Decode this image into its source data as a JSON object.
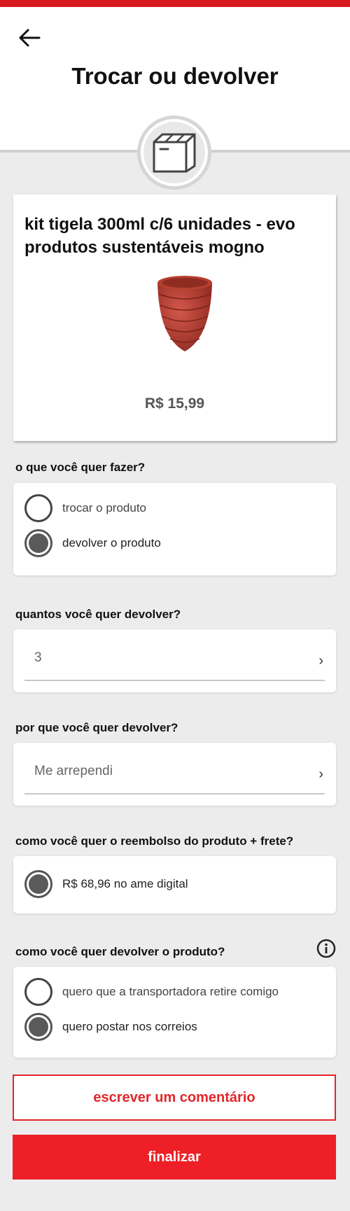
{
  "header": {
    "title": "Trocar ou devolver",
    "back_icon": "arrow-left-icon"
  },
  "product": {
    "name": "kit tigela 300ml c/6 unidades - evo produtos sustentáveis mogno",
    "price": "R$ 15,99",
    "image_icon": "bowl-stack-image"
  },
  "action": {
    "label": "o que você quer fazer?",
    "options": [
      {
        "label": "trocar o produto",
        "selected": false
      },
      {
        "label": "devolver o produto",
        "selected": true
      }
    ]
  },
  "quantity": {
    "label": "quantos você quer devolver?",
    "value": "3"
  },
  "reason": {
    "label": "por que você quer devolver?",
    "value": "Me arrependi"
  },
  "refund": {
    "label": "como você quer o reembolso do produto + frete?",
    "options": [
      {
        "label": "R$ 68,96 no ame digital",
        "selected": true
      }
    ]
  },
  "return_method": {
    "label": "como você quer devolver o produto?",
    "info_icon": "info-icon",
    "options": [
      {
        "label": "quero que a transportadora retire comigo",
        "selected": false
      },
      {
        "label": "quero postar nos correios",
        "selected": true
      }
    ]
  },
  "buttons": {
    "comment": "escrever um comentário",
    "finish": "finalizar"
  },
  "colors": {
    "accent": "#ee1f26",
    "statusbar": "#d81a20"
  }
}
